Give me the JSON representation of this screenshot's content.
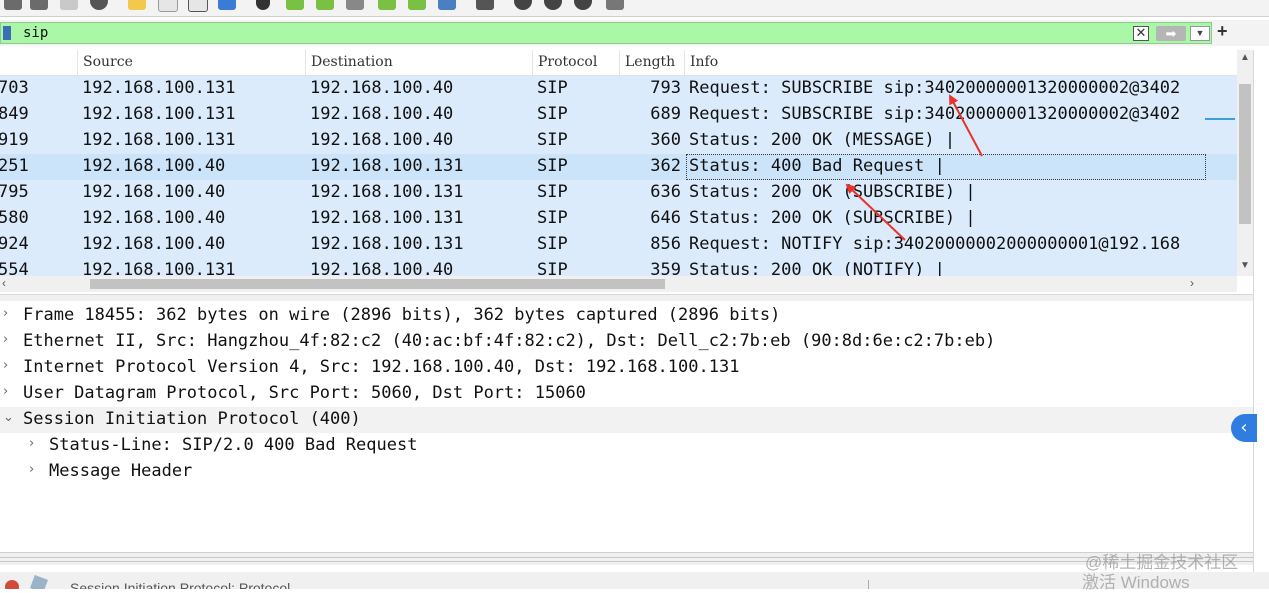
{
  "filter": {
    "value": "sip"
  },
  "columns": {
    "source": "Source",
    "destination": "Destination",
    "protocol": "Protocol",
    "length": "Length",
    "info": "Info"
  },
  "packets": [
    {
      "no": "703",
      "src": "192.168.100.131",
      "dst": "192.168.100.40",
      "proto": "SIP",
      "len": "793",
      "info": "Request: SUBSCRIBE sip:34020000001320000002@3402"
    },
    {
      "no": "849",
      "src": "192.168.100.131",
      "dst": "192.168.100.40",
      "proto": "SIP",
      "len": "689",
      "info": "Request: SUBSCRIBE sip:34020000001320000002@3402"
    },
    {
      "no": "919",
      "src": "192.168.100.131",
      "dst": "192.168.100.40",
      "proto": "SIP",
      "len": "360",
      "info": "Status: 200 OK (MESSAGE) |"
    },
    {
      "no": "251",
      "src": "192.168.100.40",
      "dst": "192.168.100.131",
      "proto": "SIP",
      "len": "362",
      "info": "Status: 400 Bad Request |"
    },
    {
      "no": "795",
      "src": "192.168.100.40",
      "dst": "192.168.100.131",
      "proto": "SIP",
      "len": "636",
      "info": "Status: 200 OK (SUBSCRIBE) |"
    },
    {
      "no": "580",
      "src": "192.168.100.40",
      "dst": "192.168.100.131",
      "proto": "SIP",
      "len": "646",
      "info": "Status: 200 OK (SUBSCRIBE) |"
    },
    {
      "no": "924",
      "src": "192.168.100.40",
      "dst": "192.168.100.131",
      "proto": "SIP",
      "len": "856",
      "info": "Request: NOTIFY sip:34020000002000000001@192.168"
    },
    {
      "no": "554",
      "src": "192.168.100.131",
      "dst": "192.168.100.40",
      "proto": "SIP",
      "len": "359",
      "info": "Status: 200 OK (NOTIFY) |"
    }
  ],
  "details": {
    "frame": "Frame 18455: 362 bytes on wire (2896 bits), 362 bytes captured (2896 bits)",
    "ethernet": "Ethernet II, Src: Hangzhou_4f:82:c2 (40:ac:bf:4f:82:c2), Dst: Dell_c2:7b:eb (90:8d:6e:c2:7b:eb)",
    "ip": "Internet Protocol Version 4, Src: 192.168.100.40, Dst: 192.168.100.131",
    "udp": "User Datagram Protocol, Src Port: 5060, Dst Port: 15060",
    "sip": "Session Initiation Protocol (400)",
    "status_line": "Status-Line: SIP/2.0 400 Bad Request",
    "message_header": "Message Header"
  },
  "status": {
    "text": "Session Initiation Protocol: Protocol"
  },
  "watermark": {
    "line1": "@稀土掘金技术社区",
    "line2": "激活 Windows"
  },
  "colors": {
    "filter_bg": "#aaf7a8",
    "row_bg": "#dcebfb",
    "selected_row": "#cce4fa",
    "arrow": "#e8322a",
    "collapse_btn": "#2f7de1"
  }
}
